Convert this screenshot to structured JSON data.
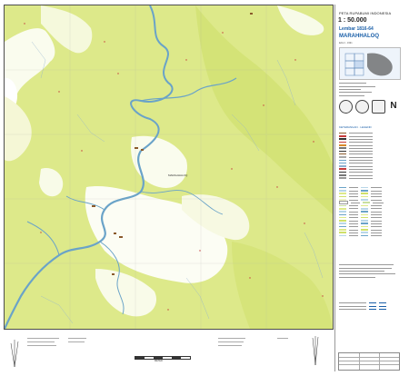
{
  "sheet": {
    "series": "PETA RUPABUMI INDONESIA",
    "scale": "1 : 50.000",
    "sheet_no": "Lembar 1816-64",
    "name": "MARAHHALOQ",
    "edition": "Edisi I - 1991"
  },
  "colors": {
    "forest": "#dde98a",
    "forest_dark": "#cfe06a",
    "clearing": "#ffffff",
    "river": "#6aa3c8",
    "settlement": "#8a5a2b",
    "accent": "#1a5fa8"
  },
  "map_labels": [
    {
      "id": "label-marahhaloq",
      "text": "MARAHHALOQ"
    }
  ],
  "legend_title": "KETERANGAN · LEGEND",
  "north_symbol": "N",
  "scale_bar_label": "METER"
}
